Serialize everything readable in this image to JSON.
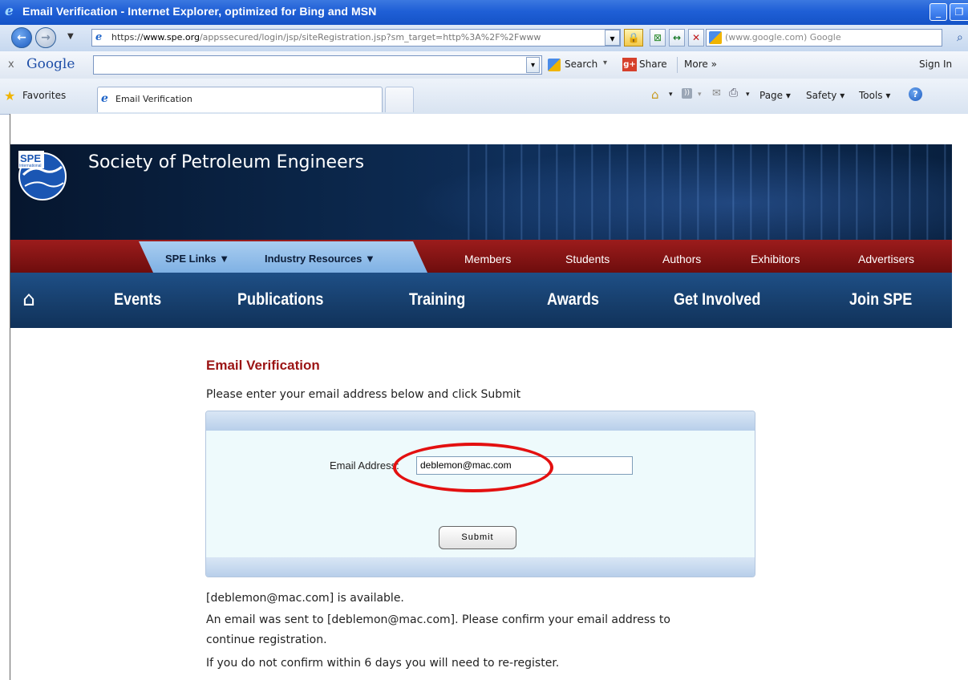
{
  "window": {
    "title": "Email Verification - Internet Explorer, optimized for Bing and MSN"
  },
  "addressbar": {
    "url_https": "https://",
    "url_domain": "www.spe.org",
    "url_path": "/appssecured/login/jsp/siteRegistration.jsp?sm_target=http%3A%2F%2Fwww",
    "search_placeholder": "(www.google.com) Google"
  },
  "google_toolbar": {
    "close": "x",
    "logo": "Google",
    "search_label": "Search",
    "share_label": "Share",
    "more_label": "More »",
    "signin_label": "Sign In"
  },
  "favorites_bar": {
    "favorites_label": "Favorites",
    "tab_label": "Email Verification",
    "page_menu": "Page ▾",
    "safety_menu": "Safety ▾",
    "tools_menu": "Tools ▾"
  },
  "site": {
    "logo_text": "SPE",
    "logo_sub": "International",
    "title": "Society of Petroleum Engineers",
    "sub_nav_left": [
      "SPE Links ▼",
      "Industry Resources ▼"
    ],
    "sub_nav_right": [
      "Members",
      "Students",
      "Authors",
      "Exhibitors",
      "Advertisers"
    ],
    "main_nav": [
      "Events",
      "Publications",
      "Training",
      "Awards",
      "Get Involved",
      "Join SPE"
    ]
  },
  "form": {
    "heading": "Email Verification",
    "instruction": "Please enter your email address below and click Submit",
    "email_label": "Email Address:",
    "email_value": "deblemon@mac.com",
    "submit_label": "Submit"
  },
  "messages": {
    "available": "[deblemon@mac.com] is available.",
    "sent_line1": "An email was sent to [deblemon@mac.com]. Please confirm your email address to",
    "sent_line2": "continue registration.",
    "warning": "If you do not confirm within 6 days you will need to re-register."
  }
}
